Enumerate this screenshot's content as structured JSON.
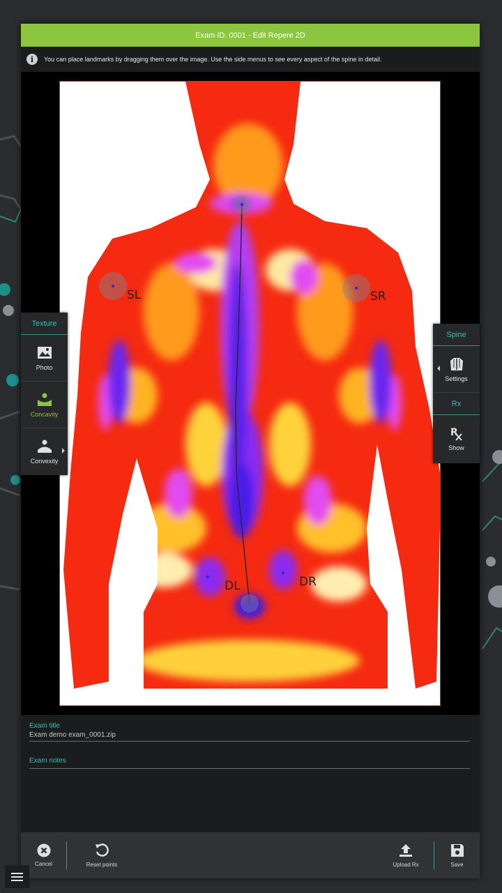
{
  "dialog": {
    "title": "Exam ID: 0001 - Edit Repere 2D",
    "info_text": "You can place landmarks by dragging them over the image. Use the side menus to see every aspect of the spine in detail."
  },
  "landmarks": {
    "sl": "SL",
    "sr": "SR",
    "dl": "DL",
    "dr": "DR"
  },
  "left_panel": {
    "header": "Texture",
    "items": [
      {
        "label": "Photo",
        "icon": "photo-icon"
      },
      {
        "label": "Concavity",
        "icon": "concavity-icon",
        "active": true
      },
      {
        "label": "Convexity",
        "icon": "convexity-icon"
      }
    ]
  },
  "right_panel": {
    "spine_header": "Spine",
    "settings_label": "Settings",
    "rx_header": "Rx",
    "show_label": "Show"
  },
  "form": {
    "exam_title_label": "Exam title",
    "exam_title_value": "Exam demo exam_0001.zip",
    "exam_notes_label": "Exam notes",
    "exam_notes_value": ""
  },
  "toolbar": {
    "cancel": "Cancel",
    "reset_points": "Reset points",
    "upload_rx": "Upload Rx",
    "save": "Save"
  },
  "colors": {
    "accent_green": "#8cc63f",
    "accent_teal": "#2fc1b5",
    "dialog_bg": "#1b1c1e"
  }
}
